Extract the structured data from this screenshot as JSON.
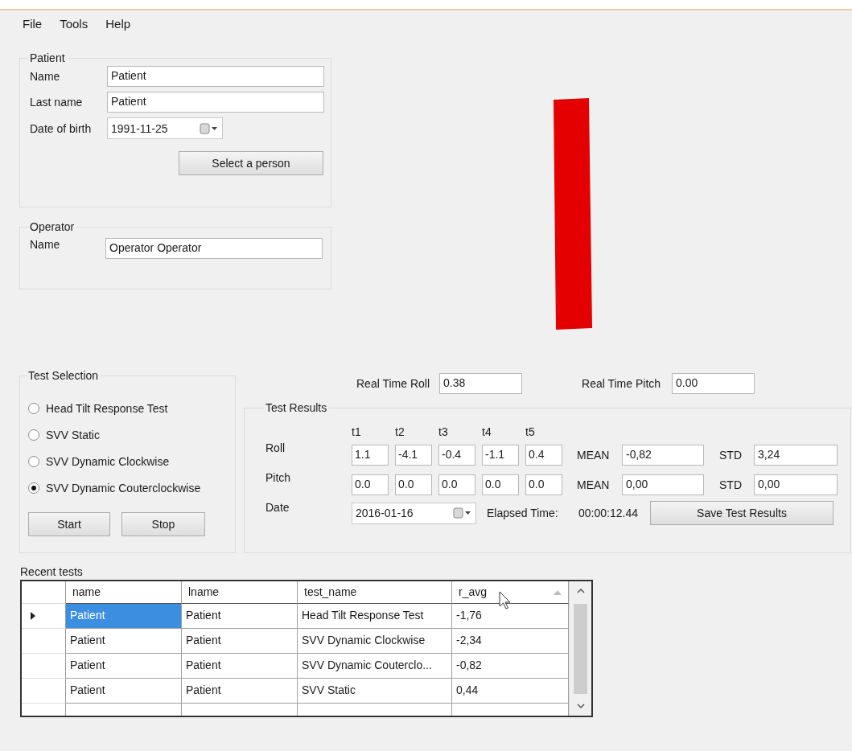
{
  "menu": [
    "File",
    "Tools",
    "Help"
  ],
  "patient": {
    "title": "Patient",
    "fields": [
      {
        "label": "Name",
        "value": "Patient",
        "kind": "text"
      },
      {
        "label": "Last name",
        "value": "Patient",
        "kind": "text"
      },
      {
        "label": "Date of birth",
        "value": "1991-11-25",
        "kind": "date"
      }
    ],
    "button": "Select a person"
  },
  "operator": {
    "title": "Operator",
    "fields": [
      {
        "label": "Name",
        "value": "Operator Operator"
      }
    ]
  },
  "test_selection": {
    "title": "Test Selection",
    "options": [
      {
        "label": "Head Tilt Response Test",
        "selected": false
      },
      {
        "label": "SVV Static",
        "selected": false
      },
      {
        "label": "SVV Dynamic Clockwise",
        "selected": false
      },
      {
        "label": "SVV Dynamic Couterclockwise",
        "selected": true
      }
    ],
    "buttons": [
      "Start",
      "Stop"
    ]
  },
  "real_time": [
    {
      "label": "Real Time Roll",
      "value": "0.38"
    },
    {
      "label": "Real Time Pitch",
      "value": "0.00"
    }
  ],
  "test_results": {
    "title": "Test Results",
    "columns": [
      "t1",
      "t2",
      "t3",
      "t4",
      "t5"
    ],
    "rows": [
      {
        "label": "Roll",
        "values": [
          "1.1",
          "-4.1",
          "-0.4",
          "-1.1",
          "0.4"
        ],
        "mean_label": "MEAN",
        "mean": "-0,82",
        "std_label": "STD",
        "std": "3,24"
      },
      {
        "label": "Pitch",
        "values": [
          "0.0",
          "0.0",
          "0.0",
          "0.0",
          "0.0"
        ],
        "mean_label": "MEAN",
        "mean": "0,00",
        "std_label": "STD",
        "std": "0,00"
      }
    ],
    "date_label": "Date",
    "date": "2016-01-16",
    "elapsed_label": "Elapsed Time:",
    "elapsed": "00:00:12.44",
    "save_button": "Save Test Results"
  },
  "recent_tests": {
    "title": "Recent tests",
    "columns": [
      "name",
      "lname",
      "test_name",
      "r_avg"
    ],
    "rows": [
      {
        "selected": true,
        "cells": [
          "Patient",
          "Patient",
          "Head Tilt Response Test",
          "-1,76"
        ]
      },
      {
        "selected": false,
        "cells": [
          "Patient",
          "Patient",
          "SVV Dynamic Clockwise",
          "-2,34"
        ]
      },
      {
        "selected": false,
        "cells": [
          "Patient",
          "Patient",
          "SVV Dynamic Couterclo...",
          "-0,82"
        ]
      },
      {
        "selected": false,
        "cells": [
          "Patient",
          "Patient",
          "SVV Static",
          "0,44"
        ]
      }
    ]
  }
}
